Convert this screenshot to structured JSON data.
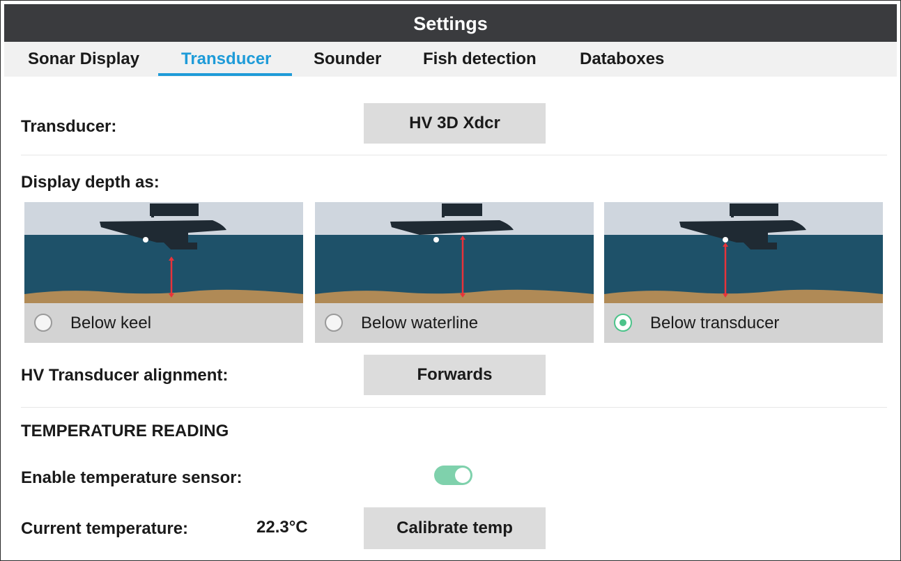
{
  "window": {
    "title": "Settings"
  },
  "tabs": [
    {
      "label": "Sonar Display",
      "active": false
    },
    {
      "label": "Transducer",
      "active": true
    },
    {
      "label": "Sounder",
      "active": false
    },
    {
      "label": "Fish detection",
      "active": false
    },
    {
      "label": "Databoxes",
      "active": false
    }
  ],
  "transducer": {
    "label": "Transducer:",
    "value": "HV 3D Xdcr"
  },
  "depth": {
    "label": "Display depth as:",
    "options": [
      {
        "label": "Below keel",
        "selected": false
      },
      {
        "label": "Below waterline",
        "selected": false
      },
      {
        "label": "Below transducer",
        "selected": true
      }
    ]
  },
  "alignment": {
    "label": "HV Transducer alignment:",
    "value": "Forwards"
  },
  "temperature": {
    "section_title": "TEMPERATURE READING",
    "enable_label": "Enable temperature sensor:",
    "enabled": true,
    "current_label": "Current temperature:",
    "current_value": "22.3°C",
    "calibrate_label": "Calibrate temp"
  },
  "colors": {
    "accent": "#1e9bd8",
    "toggle_on": "#7fd1ac",
    "radio_selected": "#4cc38a",
    "sky": "#cfd6de",
    "water": "#1e5169",
    "seabed": "#b08a56",
    "hull": "#1f2a33",
    "depth_arrow": "#e8333a"
  }
}
